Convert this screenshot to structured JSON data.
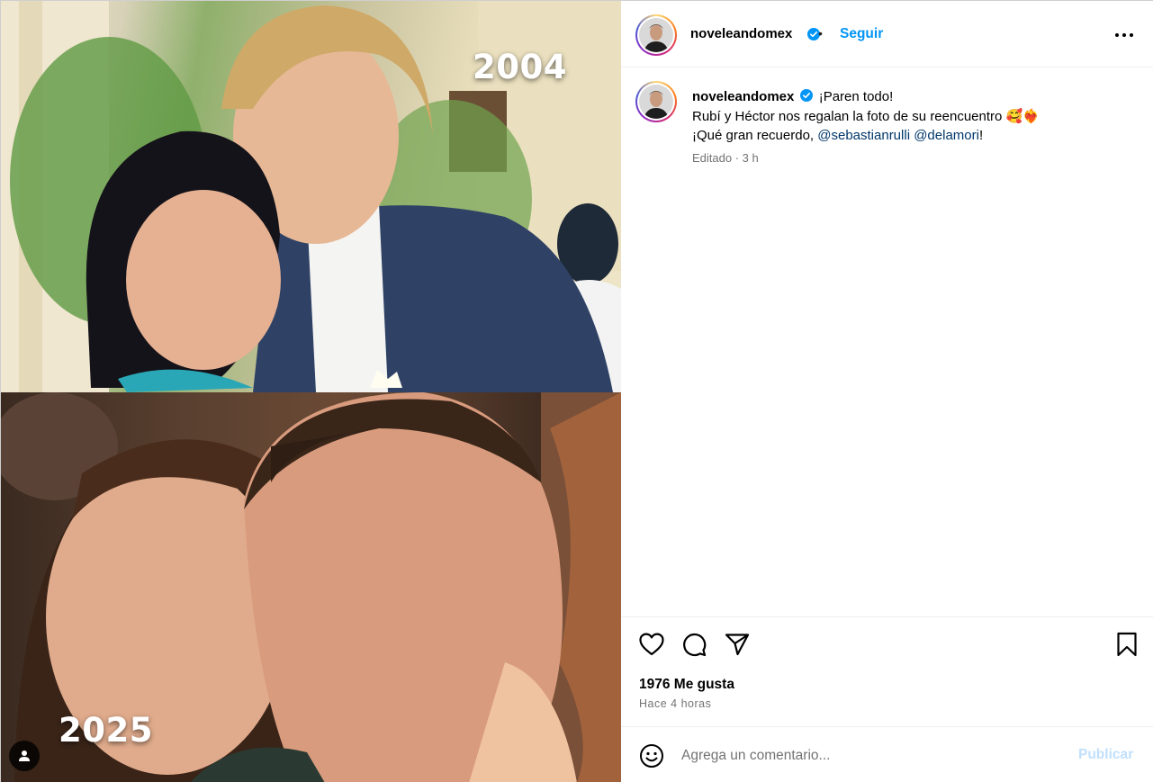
{
  "media": {
    "year_top": "2004",
    "year_bottom": "2025"
  },
  "header": {
    "username": "noveleandomex",
    "separator": "•",
    "follow_label": "Seguir"
  },
  "caption": {
    "username": "noveleandomex",
    "line1": "¡Paren todo!",
    "line2": "Rubí y Héctor nos regalan la foto de su reencuentro 🥰❤️‍🔥",
    "line3_text": "¡Qué gran recuerdo, ",
    "mention1": "@sebastianrulli",
    "mention2": "@delamori",
    "line3_end": "!",
    "edited": "Editado · 3 h"
  },
  "actions": {
    "icons": [
      "heart-icon",
      "comment-icon",
      "share-icon",
      "bookmark-icon"
    ],
    "likes": "1976 Me gusta",
    "time": "Hace 4 horas"
  },
  "comment": {
    "placeholder": "Agrega un comentario...",
    "publish_label": "Publicar"
  },
  "colors": {
    "accent": "#0095f6",
    "mention": "#00376b",
    "muted": "#737373",
    "publish_disabled": "#c0dffd"
  }
}
